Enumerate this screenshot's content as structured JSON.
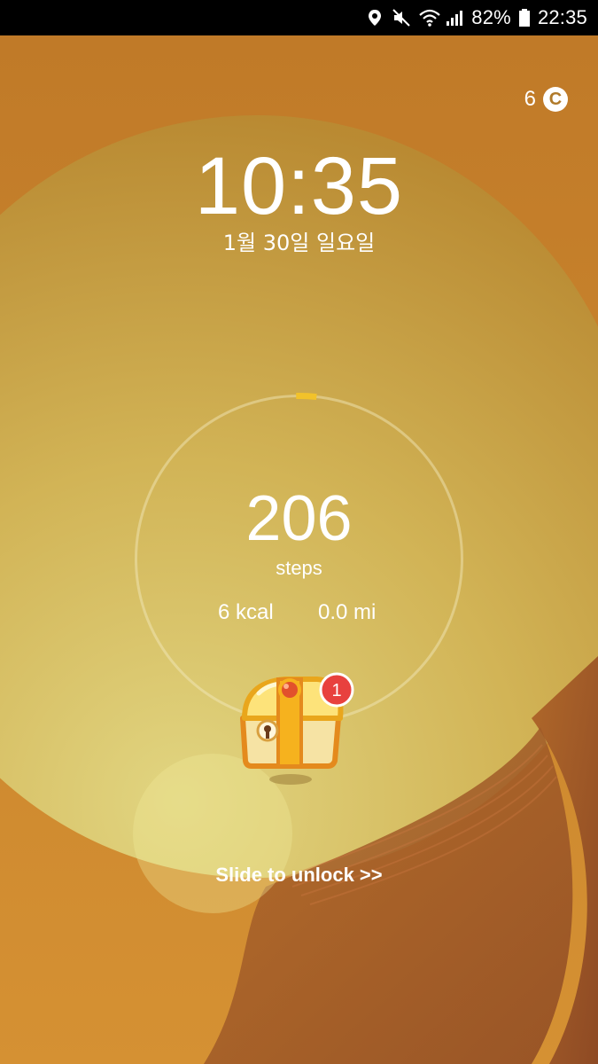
{
  "status_bar": {
    "battery_percent": "82%",
    "time": "22:35",
    "icons": [
      "location-icon",
      "mute-icon",
      "wifi-icon",
      "signal-icon",
      "battery-icon"
    ]
  },
  "indicator": {
    "value": "6",
    "badge": "C"
  },
  "lock": {
    "time": "10:35",
    "date": "1월 30일 일요일"
  },
  "steps": {
    "count": "206",
    "label": "steps",
    "kcal": "6 kcal",
    "distance": "0.0 mi",
    "progress_fraction": 0.02
  },
  "reward": {
    "icon": "treasure-chest-icon",
    "badge_count": "1"
  },
  "unlock": {
    "hint": "Slide to unlock >>"
  },
  "colors": {
    "accent": "#f2c22a",
    "badge_red": "#e8413e",
    "text": "#ffffff"
  }
}
